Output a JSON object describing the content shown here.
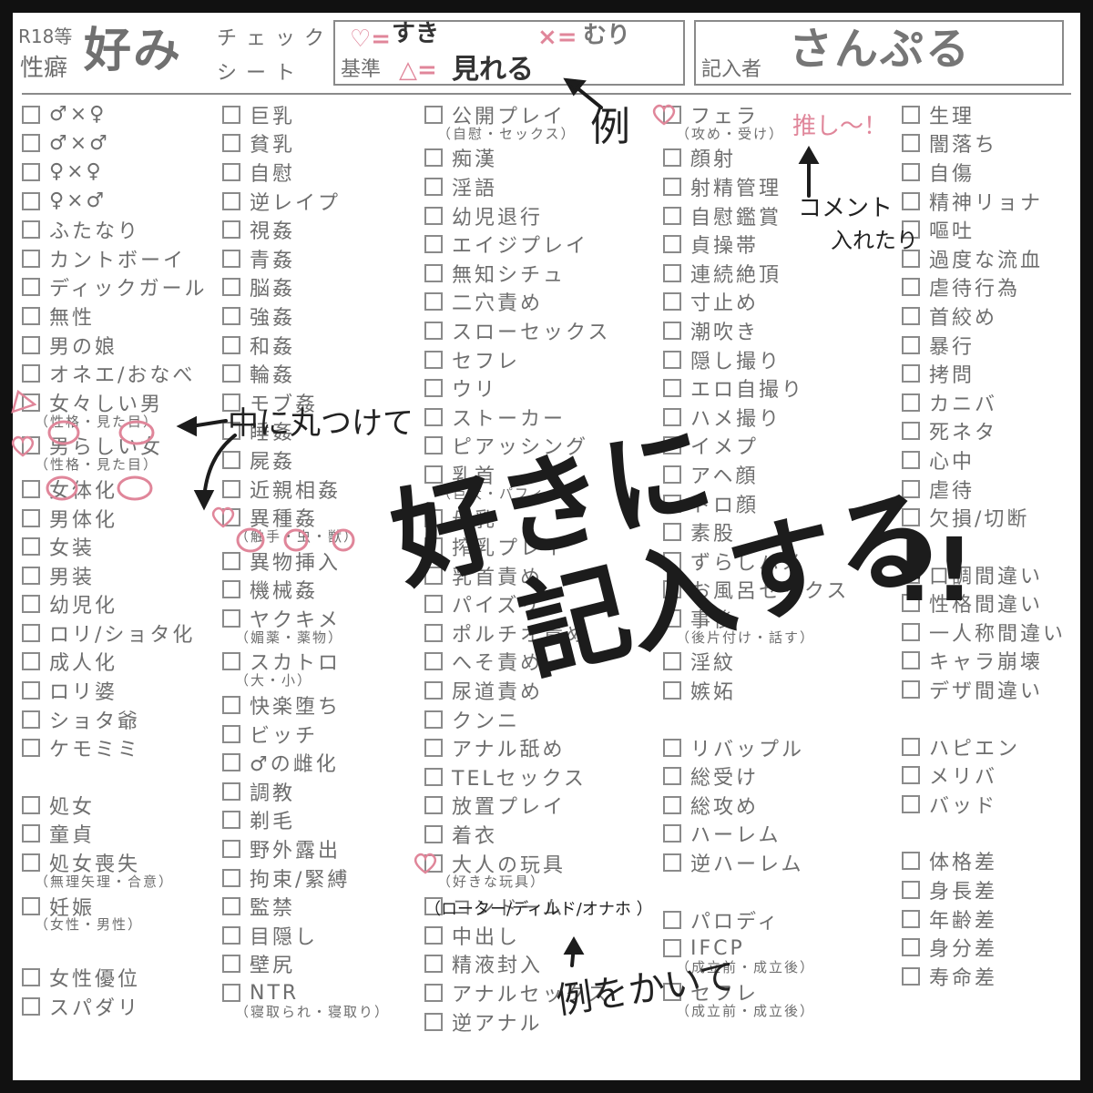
{
  "header": {
    "prefix_top": "R18等",
    "prefix_bottom": "性癖",
    "title": "好み",
    "subtitle_top": "チェック",
    "subtitle_bottom": "シート",
    "legend_label": "基準",
    "legend": [
      {
        "symbol": "heart",
        "text": "すき",
        "color": "#e0869a"
      },
      {
        "symbol": "triangle",
        "text": "見れる",
        "color": "#e0869a"
      },
      {
        "symbol": "cross",
        "text": "むり",
        "color": "#e0869a"
      }
    ],
    "writer_label": "記入者",
    "writer_name": "さんぷる"
  },
  "columns": [
    {
      "items": [
        {
          "label": "♂×♀"
        },
        {
          "label": "♂×♂"
        },
        {
          "label": "♀×♀"
        },
        {
          "label": "♀×♂"
        },
        {
          "label": "ふたなり"
        },
        {
          "label": "カントボーイ"
        },
        {
          "label": "ディックガール"
        },
        {
          "label": "無性"
        },
        {
          "label": "男の娘"
        },
        {
          "label": "オネエ/おなべ"
        },
        {
          "label": "女々しい男",
          "sub": "（性格・見た目）",
          "mark": "triangle"
        },
        {
          "label": "男らしい女",
          "sub": "（性格・見た目）",
          "mark": "heart"
        },
        {
          "label": "女体化"
        },
        {
          "label": "男体化"
        },
        {
          "label": "女装"
        },
        {
          "label": "男装"
        },
        {
          "label": "幼児化"
        },
        {
          "label": "ロリ/ショタ化"
        },
        {
          "label": "成人化"
        },
        {
          "label": "ロリ婆"
        },
        {
          "label": "ショタ爺"
        },
        {
          "label": "ケモミミ"
        },
        {
          "gap": true
        },
        {
          "label": "処女"
        },
        {
          "label": "童貞"
        },
        {
          "label": "処女喪失",
          "sub": "（無理矢理・合意）"
        },
        {
          "label": "妊娠",
          "sub": "（女性・男性）"
        },
        {
          "gap": true
        },
        {
          "label": "女性優位"
        },
        {
          "label": "スパダリ"
        }
      ]
    },
    {
      "items": [
        {
          "label": "巨乳"
        },
        {
          "label": "貧乳"
        },
        {
          "label": "自慰"
        },
        {
          "label": "逆レイプ"
        },
        {
          "label": "視姦"
        },
        {
          "label": "青姦"
        },
        {
          "label": "脳姦"
        },
        {
          "label": "強姦"
        },
        {
          "label": "和姦"
        },
        {
          "label": "輪姦"
        },
        {
          "label": "モブ姦"
        },
        {
          "label": "睡姦"
        },
        {
          "label": "屍姦"
        },
        {
          "label": "近親相姦"
        },
        {
          "label": "異種姦",
          "sub": "（触手・虫・獣）",
          "mark": "heart"
        },
        {
          "label": "異物挿入"
        },
        {
          "label": "機械姦"
        },
        {
          "label": "ヤクキメ",
          "sub": "（媚薬・薬物）"
        },
        {
          "label": "スカトロ",
          "sub": "（大・小）"
        },
        {
          "label": "快楽堕ち"
        },
        {
          "label": "ビッチ"
        },
        {
          "label": "♂の雌化"
        },
        {
          "label": "調教"
        },
        {
          "label": "剃毛"
        },
        {
          "label": "野外露出"
        },
        {
          "label": "拘束/緊縛"
        },
        {
          "label": "監禁"
        },
        {
          "label": "目隠し"
        },
        {
          "label": "壁尻"
        },
        {
          "label": "NTR",
          "sub": "（寝取られ・寝取り）"
        }
      ]
    },
    {
      "items": [
        {
          "label": "公開プレイ",
          "sub": "（自慰・セックス）"
        },
        {
          "label": "痴漢"
        },
        {
          "label": "淫語"
        },
        {
          "label": "幼児退行"
        },
        {
          "label": "エイジプレイ"
        },
        {
          "label": "無知シチュ"
        },
        {
          "label": "二穴責め"
        },
        {
          "label": "スローセックス"
        },
        {
          "label": "セフレ"
        },
        {
          "label": "ウリ"
        },
        {
          "label": "ストーカー"
        },
        {
          "label": "ピアッシング"
        },
        {
          "label": "乳首",
          "sub": "（巨大・パフィー）"
        },
        {
          "label": "母乳"
        },
        {
          "label": "搾乳プレイ"
        },
        {
          "label": "乳首責め"
        },
        {
          "label": "パイズリ"
        },
        {
          "label": "ポルチオ責め"
        },
        {
          "label": "へそ責め"
        },
        {
          "label": "尿道責め"
        },
        {
          "label": "クンニ"
        },
        {
          "label": "アナル舐め"
        },
        {
          "label": "TELセックス"
        },
        {
          "label": "放置プレイ"
        },
        {
          "label": "着衣"
        },
        {
          "label": "大人の玩具",
          "sub": "（好きな玩具）",
          "mark": "heart"
        },
        {
          "label": "コンドーム"
        },
        {
          "label": "中出し"
        },
        {
          "label": "精液封入"
        },
        {
          "label": "アナルセックス"
        },
        {
          "label": "逆アナル"
        }
      ]
    },
    {
      "items": [
        {
          "label": "フェラ",
          "sub": "（攻め・受け）",
          "mark": "heart"
        },
        {
          "label": "顔射"
        },
        {
          "label": "射精管理"
        },
        {
          "label": "自慰鑑賞"
        },
        {
          "label": "貞操帯"
        },
        {
          "label": "連続絶頂"
        },
        {
          "label": "寸止め"
        },
        {
          "label": "潮吹き"
        },
        {
          "label": "隠し撮り"
        },
        {
          "label": "エロ自撮り"
        },
        {
          "label": "ハメ撮り"
        },
        {
          "label": "イメプ"
        },
        {
          "label": "アヘ顔"
        },
        {
          "label": "トロ顔"
        },
        {
          "label": "素股"
        },
        {
          "label": "ずらしハメ"
        },
        {
          "label": "お風呂セックス"
        },
        {
          "label": "事後",
          "sub": "（後片付け・話す）"
        },
        {
          "label": "淫紋"
        },
        {
          "label": "嫉妬"
        },
        {
          "gap": true
        },
        {
          "label": "リバップル"
        },
        {
          "label": "総受け"
        },
        {
          "label": "総攻め"
        },
        {
          "label": "ハーレム"
        },
        {
          "label": "逆ハーレム"
        },
        {
          "gap": true
        },
        {
          "label": "パロディ"
        },
        {
          "label": "IFCP",
          "sub": "（成立前・成立後）"
        },
        {
          "label": "セフレ",
          "sub": "（成立前・成立後）"
        }
      ]
    },
    {
      "items": [
        {
          "label": "生理"
        },
        {
          "label": "闇落ち"
        },
        {
          "label": "自傷"
        },
        {
          "label": "精神リョナ"
        },
        {
          "label": "嘔吐"
        },
        {
          "label": "過度な流血"
        },
        {
          "label": "虐待行為"
        },
        {
          "label": "首絞め"
        },
        {
          "label": "暴行"
        },
        {
          "label": "拷問"
        },
        {
          "label": "カニバ"
        },
        {
          "label": "死ネタ"
        },
        {
          "label": "心中"
        },
        {
          "label": "虐待"
        },
        {
          "label": "欠損/切断"
        },
        {
          "gap": true
        },
        {
          "label": "口調間違い"
        },
        {
          "label": "性格間違い"
        },
        {
          "label": "一人称間違い"
        },
        {
          "label": "キャラ崩壊"
        },
        {
          "label": "デザ間違い"
        },
        {
          "gap": true
        },
        {
          "label": "ハピエン"
        },
        {
          "label": "メリバ"
        },
        {
          "label": "バッド"
        },
        {
          "gap": true
        },
        {
          "label": "体格差"
        },
        {
          "label": "身長差"
        },
        {
          "label": "年齢差"
        },
        {
          "label": "身分差"
        },
        {
          "label": "寿命差"
        }
      ]
    }
  ],
  "annotations": {
    "big_line1": "好きに",
    "big_line2": "記入する",
    "big_exclaim": "!!",
    "example_label": "例",
    "circle_hint": "中に丸つけて",
    "comment_hint_line1": "コメント",
    "comment_hint_line2": "入れたり",
    "comment_text": "推し〜！",
    "toys_example": "（ローター/ディルド/オナホ ）",
    "write_example": "例をかいて"
  },
  "colors": {
    "background": "#111111",
    "sheet": "#ffffff",
    "text_gray": "#6e6e6e",
    "accent_pink": "#e0869a",
    "ink": "#1c1c1c"
  }
}
